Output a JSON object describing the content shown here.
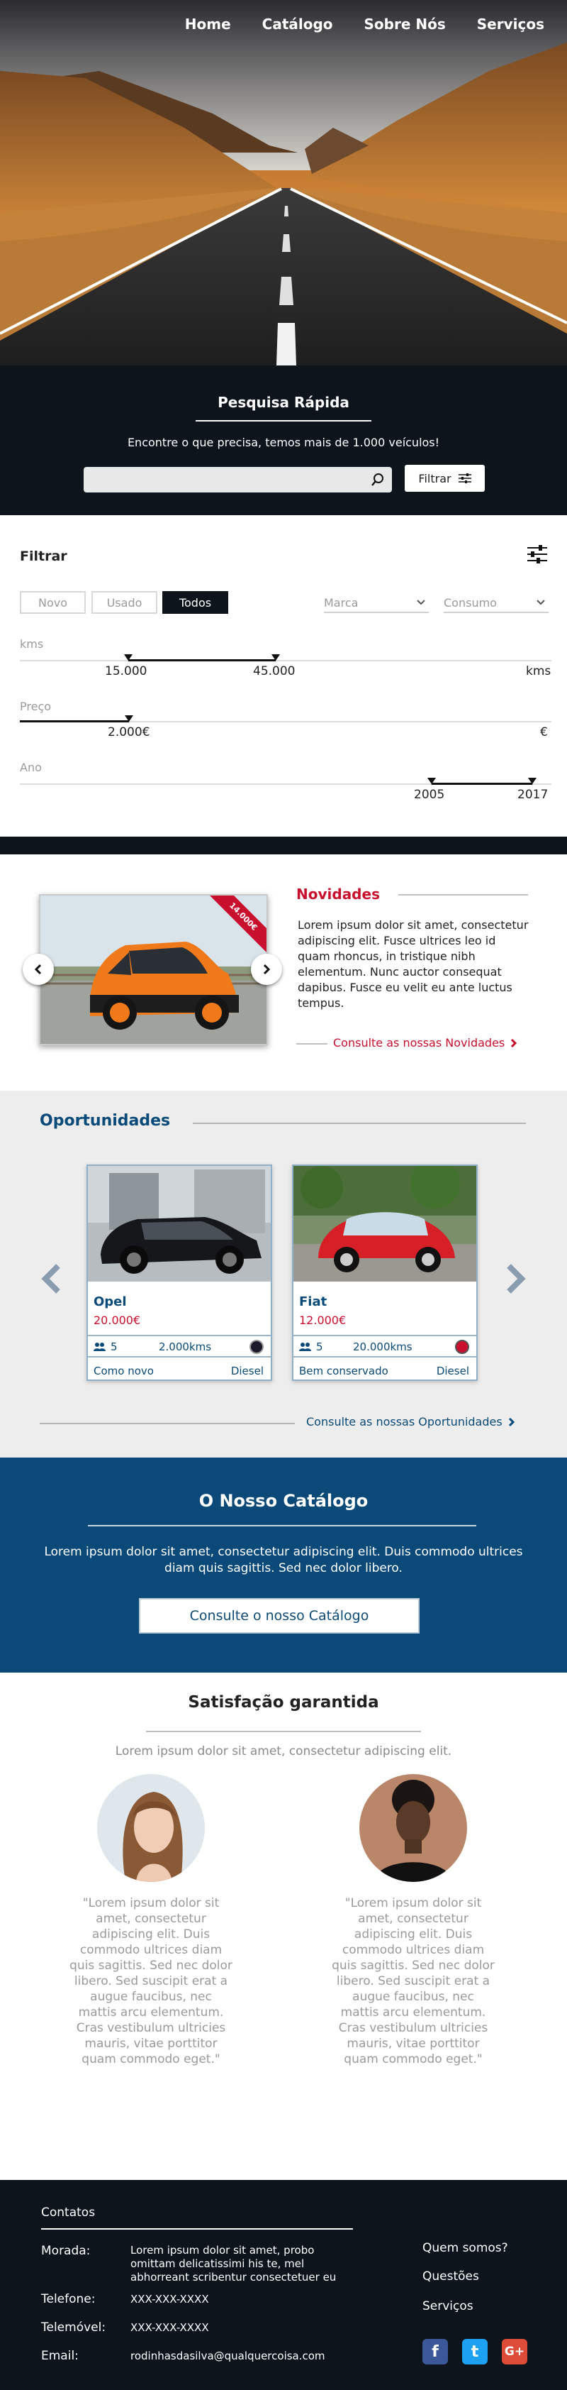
{
  "nav": {
    "items": [
      "Home",
      "Catálogo",
      "Sobre Nós",
      "Serviços"
    ]
  },
  "quick_search": {
    "title": "Pesquisa Rápida",
    "subtitle": "Encontre o que precisa, temos mais de 1.000 veículos!",
    "search_value": "",
    "filter_button": "Filtrar"
  },
  "filter": {
    "title": "Filtrar",
    "condition_tabs": [
      {
        "label": "Novo",
        "active": false
      },
      {
        "label": "Usado",
        "active": false
      },
      {
        "label": "Todos",
        "active": true
      }
    ],
    "dropdowns": {
      "brand": "Marca",
      "consumption": "Consumo"
    },
    "kms": {
      "label": "kms",
      "min": "15.000",
      "max": "45.000",
      "unit": "kms"
    },
    "price": {
      "label": "Preço",
      "value": "2.000€",
      "unit": "€"
    },
    "year": {
      "label": "Ano",
      "min": "2005",
      "max": "2017"
    }
  },
  "novidades": {
    "title": "Novidades",
    "ribbon": "14.000€",
    "text": "Lorem ipsum dolor sit amet, consectetur adipiscing elit. Fusce ultrices leo id quam rhoncus, in tristique nibh elementum. Nunc auctor consequat dapibus. Fusce eu velit eu ante luctus tempus.",
    "link": "Consulte as nossas Novidades"
  },
  "oportunidades": {
    "title": "Oportunidades",
    "cards": [
      {
        "name": "Opel",
        "price": "20.000€",
        "seats": "5",
        "kms": "2.000kms",
        "condition": "Como novo",
        "fuel": "Diesel",
        "color": "#1a1a2a"
      },
      {
        "name": "Fiat",
        "price": "12.000€",
        "seats": "5",
        "kms": "20.000kms",
        "condition": "Bem conservado",
        "fuel": "Diesel",
        "color": "#c8102e"
      }
    ],
    "link": "Consulte as nossas Oportunidades"
  },
  "catalogo": {
    "title": "O Nosso Catálogo",
    "text": "Lorem ipsum dolor sit amet, consectetur adipiscing elit. Duis commodo ultrices diam quis sagittis. Sed nec dolor libero.",
    "button": "Consulte o nosso Catálogo"
  },
  "satisfacao": {
    "title": "Satisfação garantida",
    "subtitle": "Lorem ipsum dolor sit amet, consectetur adipiscing elit.",
    "quotes": [
      "\"Lorem ipsum dolor sit amet, consectetur adipiscing elit. Duis commodo ultrices diam quis sagittis. Sed nec dolor libero. Sed suscipit erat a augue faucibus, nec mattis arcu elementum. Cras vestibulum ultricies mauris, vitae porttitor quam commodo eget.\"",
      "\"Lorem ipsum dolor sit amet, consectetur adipiscing elit. Duis commodo ultrices diam quis sagittis. Sed nec dolor libero. Sed suscipit erat a augue faucibus, nec mattis arcu elementum. Cras vestibulum ultricies mauris, vitae porttitor quam commodo eget.\""
    ]
  },
  "footer": {
    "title": "Contatos",
    "morada_label": "Morada:",
    "morada_value": "Lorem ipsum dolor sit amet, probo omittam delicatissimi his te, mel abhorreant scribentur consectetuer eu",
    "telefone_label": "Telefone:",
    "telefone_value": "XXX-XXX-XXXX",
    "telemovel_label": "Telemóvel:",
    "telemovel_value": "XXX-XXX-XXXX",
    "email_label": "Email:",
    "email_value": "rodinhasdasilva@qualquercoisa.com",
    "links": [
      "Quem somos?",
      "Questões",
      "Serviços"
    ],
    "social": [
      {
        "glyph": "f",
        "color": "#3b5998"
      },
      {
        "glyph": "t",
        "color": "#1da1f2"
      },
      {
        "glyph": "G+",
        "color": "#dd4b39"
      }
    ]
  }
}
